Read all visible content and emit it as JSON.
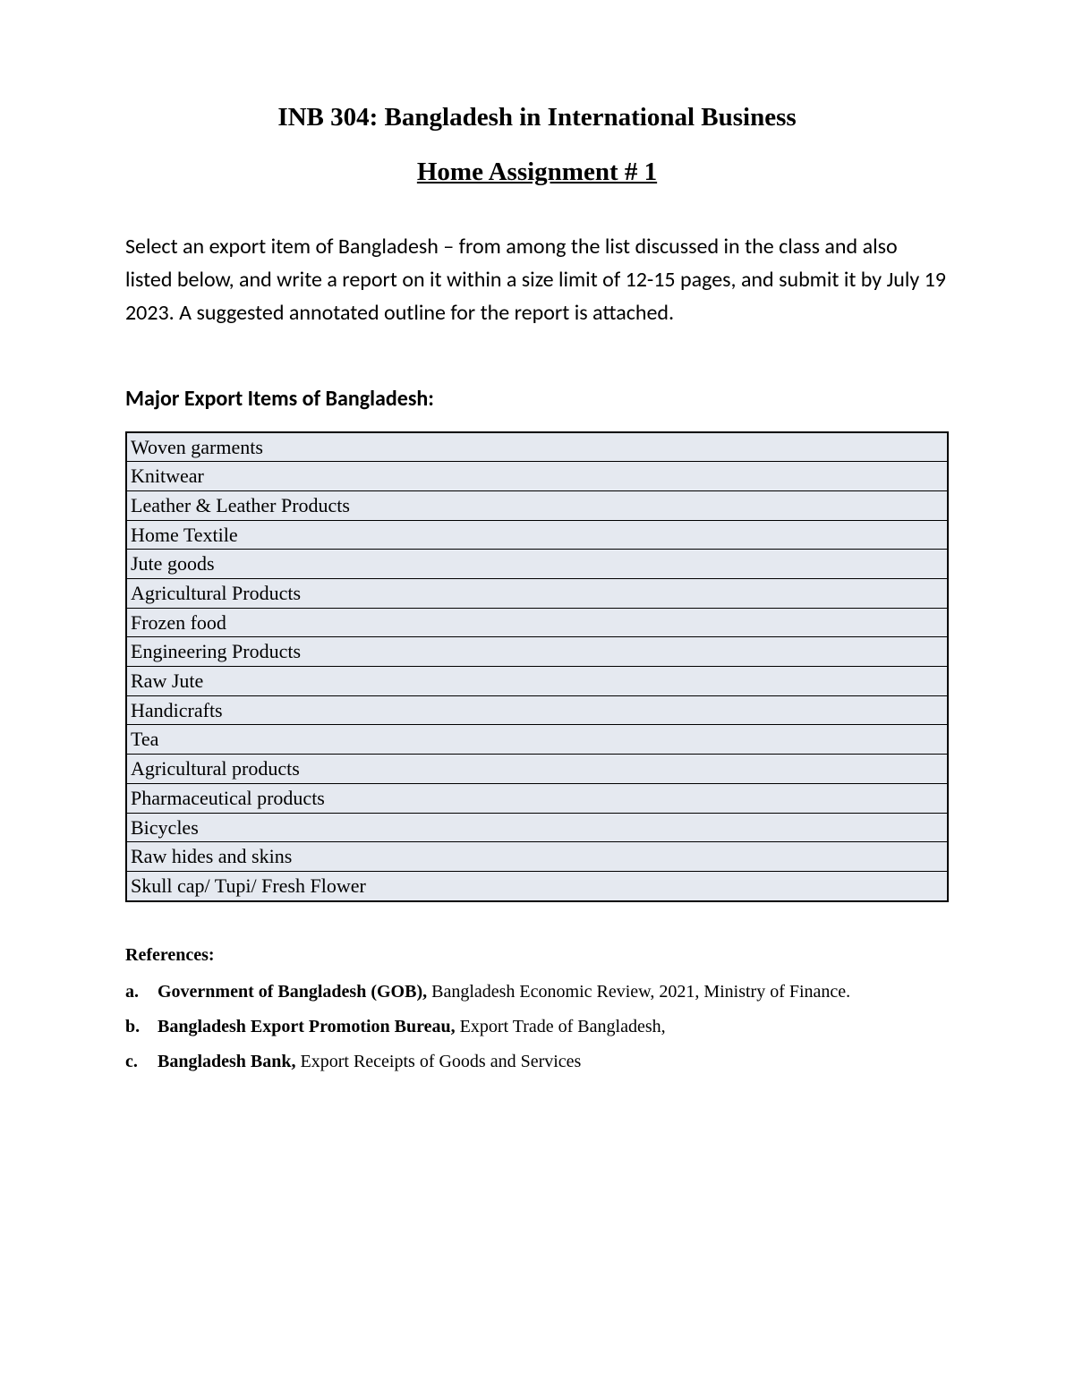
{
  "title": "INB 304: Bangladesh in International Business",
  "subtitle": "Home Assignment # 1",
  "instructions": "Select an export item of Bangladesh – from among the list discussed in the class and also listed below, and write a report on it within a size limit of 12-15 pages, and submit it by July 19 2023. A suggested annotated outline for the report is attached.",
  "section_heading": "Major Export Items of Bangladesh:",
  "export_items": [
    "Woven garments",
    "Knitwear",
    "Leather & Leather Products",
    "Home Textile",
    "Jute goods",
    "Agricultural Products",
    "Frozen food",
    "Engineering Products",
    "Raw Jute",
    "Handicrafts",
    "Tea",
    "Agricultural products",
    "Pharmaceutical  products",
    "Bicycles",
    "Raw hides and skins",
    "Skull cap/ Tupi/ Fresh Flower"
  ],
  "references_heading": "References:",
  "references": [
    {
      "letter": "a.",
      "bold": "Government of Bangladesh (GOB),   ",
      "rest": "Bangladesh Economic Review, 2021, Ministry of Finance."
    },
    {
      "letter": "b.",
      "bold": "Bangladesh Export Promotion Bureau,   ",
      "rest": "Export Trade of Bangladesh,"
    },
    {
      "letter": "c.",
      "bold": "Bangladesh Bank, ",
      "rest": "Export Receipts of Goods and Services"
    }
  ]
}
